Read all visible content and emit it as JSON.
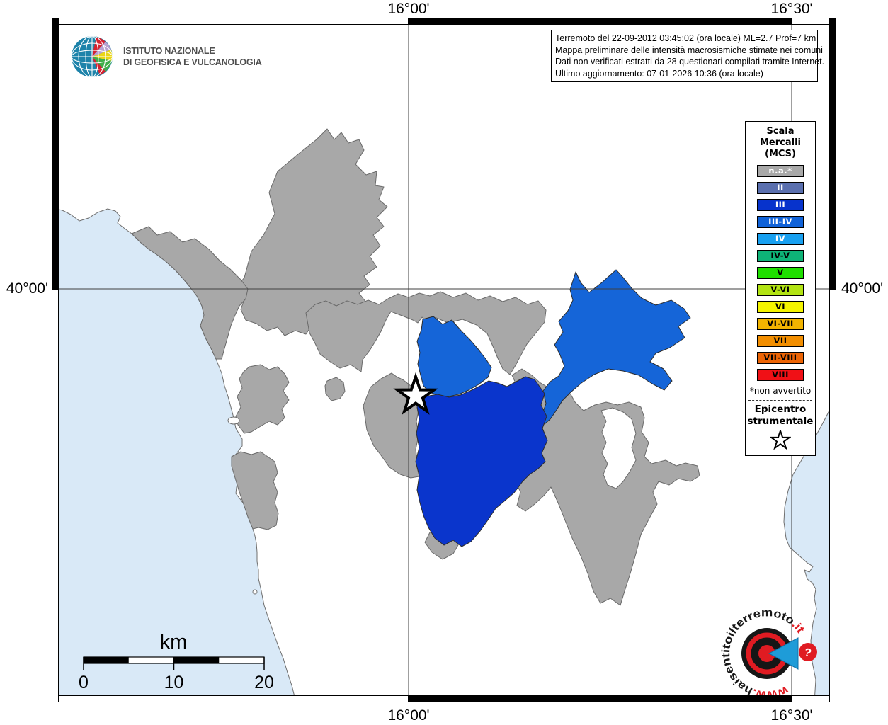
{
  "branding": {
    "line1": "ISTITUTO NAZIONALE",
    "line2": "DI GEOFISICA E VULCANOLOGIA"
  },
  "info_box": {
    "lines": [
      "Terremoto del 22-09-2012 03:45:02 (ora locale) ML=2.7 Prof=7 km",
      "Mappa preliminare delle intensità macrosismiche stimate nei comuni",
      "Dati non verificati estratti da 28 questionari compilati tramite Internet.",
      "Ultimo aggiornamento: 07-01-2026 10:36 (ora locale)"
    ]
  },
  "axis": {
    "top_left": "16°00'",
    "top_right": "16°30'",
    "bottom_left": "16°00'",
    "bottom_right": "16°30'",
    "left": "40°00'",
    "right": "40°00'"
  },
  "legend": {
    "title_lines": [
      "Scala",
      "Mercalli",
      "(MCS)"
    ],
    "items": [
      {
        "label": "n.a.*",
        "fill": "#a8a8a8",
        "text_color": "#ffffff"
      },
      {
        "label": "II",
        "fill": "#5a6fae",
        "text_color": "#ffffff"
      },
      {
        "label": "III",
        "fill": "#0733cc",
        "text_color": "#ffffff"
      },
      {
        "label": "III-IV",
        "fill": "#1062d8",
        "text_color": "#ffffff"
      },
      {
        "label": "IV",
        "fill": "#18a0f0",
        "text_color": "#ffffff"
      },
      {
        "label": "IV-V",
        "fill": "#0eb377",
        "text_color": "#000000"
      },
      {
        "label": "V",
        "fill": "#1fdf00",
        "text_color": "#000000"
      },
      {
        "label": "V-VI",
        "fill": "#b2e414",
        "text_color": "#000000"
      },
      {
        "label": "VI",
        "fill": "#f4f400",
        "text_color": "#000000"
      },
      {
        "label": "VI-VII",
        "fill": "#f2b400",
        "text_color": "#000000"
      },
      {
        "label": "VII",
        "fill": "#f28e00",
        "text_color": "#000000"
      },
      {
        "label": "VII-VIII",
        "fill": "#ec6405",
        "text_color": "#000000"
      },
      {
        "label": "VIII",
        "fill": "#f01016",
        "text_color": "#000000"
      }
    ],
    "footnote": "*non avvertito",
    "epicenter_line1": "Epicentro",
    "epicenter_line2": "strumentale",
    "epicenter_symbol": "star-outline-icon"
  },
  "scale_bar": {
    "title": "km",
    "tick_labels": [
      "0",
      "10",
      "20"
    ]
  },
  "map": {
    "sea_color": "#d9e9f7",
    "land_color": "#ffffff",
    "na_fill": "#a8a8a8",
    "grid_color": "#3f3f3f",
    "intensity_colors": {
      "III": "#0a35cc",
      "III_IV": "#1565d8"
    },
    "municipalities": [
      {
        "name": "municipality-nw",
        "intensity": "III-IV"
      },
      {
        "name": "municipality-ne",
        "intensity": "III-IV"
      },
      {
        "name": "municipality-central",
        "intensity": "III"
      }
    ],
    "epicenter": {
      "symbol": "star"
    }
  },
  "watermark": {
    "prefix": "www.",
    "middle": "haisentitoilterremoto",
    "suffix": ".it",
    "question": "?",
    "red": "#e01b22",
    "blue": "#1e9cd8",
    "dark": "#161616"
  }
}
